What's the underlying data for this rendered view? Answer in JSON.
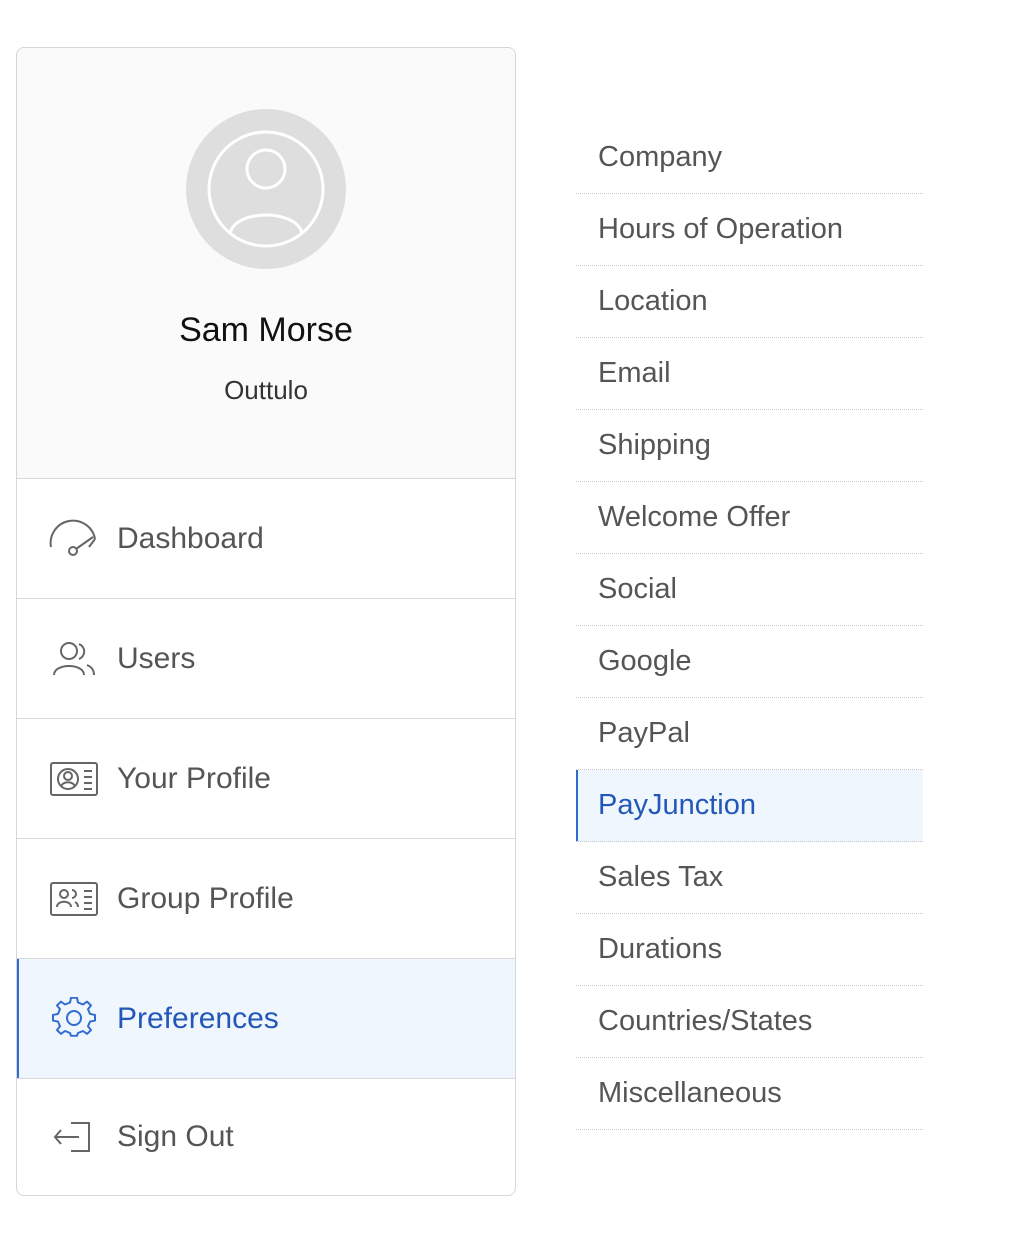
{
  "profile": {
    "name": "Sam Morse",
    "organization": "Outtulo",
    "avatar_icon": "user-circle-icon"
  },
  "nav": {
    "items": [
      {
        "label": "Dashboard",
        "icon": "gauge-icon",
        "active": false
      },
      {
        "label": "Users",
        "icon": "users-icon",
        "active": false
      },
      {
        "label": "Your Profile",
        "icon": "id-card-icon",
        "active": false
      },
      {
        "label": "Group Profile",
        "icon": "group-card-icon",
        "active": false
      },
      {
        "label": "Preferences",
        "icon": "gear-icon",
        "active": true
      },
      {
        "label": "Sign Out",
        "icon": "sign-out-icon",
        "active": false
      }
    ]
  },
  "preferences_menu": {
    "items": [
      {
        "label": "Company",
        "active": false
      },
      {
        "label": "Hours of Operation",
        "active": false
      },
      {
        "label": "Location",
        "active": false
      },
      {
        "label": "Email",
        "active": false
      },
      {
        "label": "Shipping",
        "active": false
      },
      {
        "label": "Welcome Offer",
        "active": false
      },
      {
        "label": "Social",
        "active": false
      },
      {
        "label": "Google",
        "active": false
      },
      {
        "label": "PayPal",
        "active": false
      },
      {
        "label": "PayJunction",
        "active": true
      },
      {
        "label": "Sales Tax",
        "active": false
      },
      {
        "label": "Durations",
        "active": false
      },
      {
        "label": "Countries/States",
        "active": false
      },
      {
        "label": "Miscellaneous",
        "active": false
      }
    ]
  },
  "colors": {
    "accent": "#2458b8",
    "active_bg": "#eff6fd",
    "text_muted": "#555555"
  }
}
